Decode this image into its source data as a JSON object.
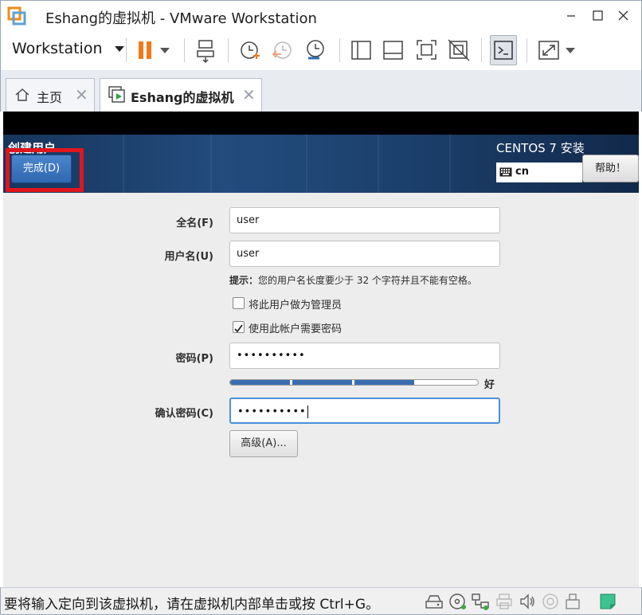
{
  "window": {
    "title": "Eshang的虚拟机 - VMware Workstation",
    "icons": [
      "vmware-logo-icon",
      "minimize-icon",
      "maximize-icon",
      "close-icon"
    ]
  },
  "toolbar": {
    "workstation_menu": "Workstation",
    "icons": [
      "pause-icon",
      "dropdown-arrow-icon",
      "send-ctrl-alt-del-icon",
      "snapshot-take-icon",
      "snapshot-revert-icon",
      "snapshot-manager-icon",
      "library-view-icon",
      "thumbnail-view-icon",
      "full-screen-icon",
      "unity-icon",
      "console-view-icon",
      "stretch-view-icon"
    ]
  },
  "tabs": [
    {
      "label": "主页",
      "icon": "home-icon",
      "active": false
    },
    {
      "label": "Eshang的虚拟机",
      "icon": "vm-running-icon",
      "active": true
    }
  ],
  "installer": {
    "heading": "创建用户",
    "done_button": "完成(D)",
    "product": "CENTOS 7 安装",
    "keyboard_layout": "cn",
    "help_button": "帮助！",
    "fields": {
      "fullname_label": "全名(F)",
      "fullname_value": "user",
      "username_label": "用户名(U)",
      "username_value": "user",
      "hint_bold": "提示：",
      "hint_text": "您的用户名长度要少于 32 个字符并且不能有空格。",
      "admin_checkbox": "将此用户做为管理员",
      "admin_checked": false,
      "require_pwd_checkbox": "使用此帐户需要密码",
      "require_pwd_checked": true,
      "password_label": "密码(P)",
      "password_value": "••••••••••",
      "strength_label": "好",
      "strength_fraction": 0.75,
      "confirm_label": "确认密码(C)",
      "confirm_value": "••••••••••",
      "advanced_button": "高级(A)..."
    },
    "colors": {
      "header_blue": "#1f4675",
      "done_blue": "#3b73bd",
      "highlight_red": "#e0161d",
      "strength_blue": "#3a6db0",
      "focus_blue": "#4a90d9"
    }
  },
  "statusbar": {
    "text": "要将输入定向到该虚拟机，请在虚拟机内部单击或按 Ctrl+G。",
    "icons": [
      "hard-disk-icon",
      "cd-dvd-icon",
      "network-icon",
      "printer-icon",
      "sound-icon",
      "usb-camera-icon",
      "usb-device-icon",
      "message-log-icon"
    ]
  }
}
